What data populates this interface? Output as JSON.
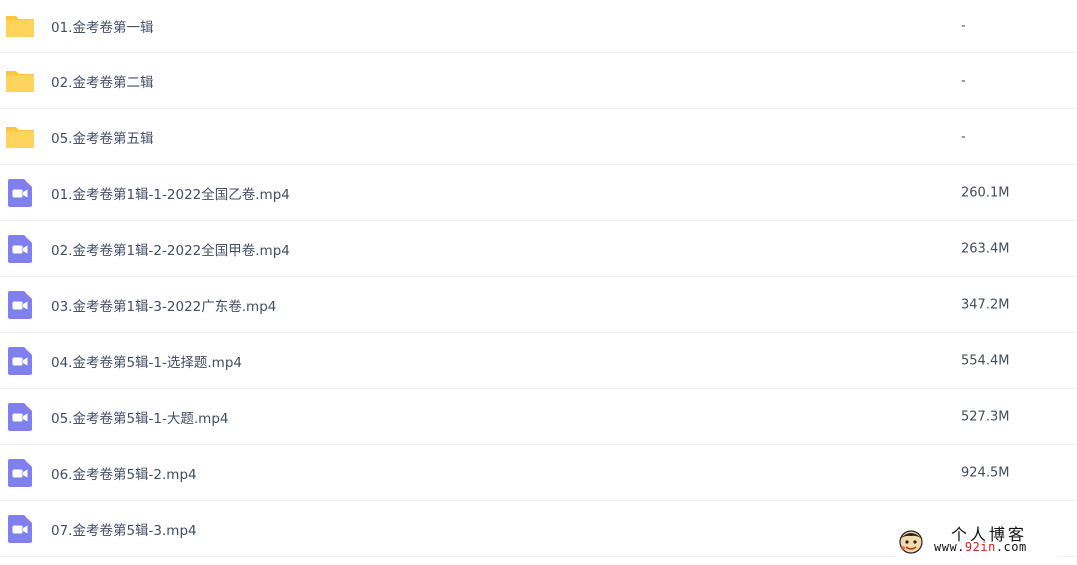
{
  "files": [
    {
      "type": "folder",
      "icon": "folder-icon",
      "name": "01.金考卷第一辑",
      "size": "-"
    },
    {
      "type": "folder",
      "icon": "folder-icon",
      "name": "02.金考卷第二辑",
      "size": "-"
    },
    {
      "type": "folder",
      "icon": "folder-icon",
      "name": "05.金考卷第五辑",
      "size": "-"
    },
    {
      "type": "video",
      "icon": "video-file-icon",
      "name": "01.金考卷第1辑-1-2022全国乙卷.mp4",
      "size": "260.1M"
    },
    {
      "type": "video",
      "icon": "video-file-icon",
      "name": "02.金考卷第1辑-2-2022全国甲卷.mp4",
      "size": "263.4M"
    },
    {
      "type": "video",
      "icon": "video-file-icon",
      "name": "03.金考卷第1辑-3-2022广东卷.mp4",
      "size": "347.2M"
    },
    {
      "type": "video",
      "icon": "video-file-icon",
      "name": "04.金考卷第5辑-1-选择题.mp4",
      "size": "554.4M"
    },
    {
      "type": "video",
      "icon": "video-file-icon",
      "name": "05.金考卷第5辑-1-大题.mp4",
      "size": "527.3M"
    },
    {
      "type": "video",
      "icon": "video-file-icon",
      "name": "06.金考卷第5辑-2.mp4",
      "size": "924.5M"
    },
    {
      "type": "video",
      "icon": "video-file-icon",
      "name": "07.金考卷第5辑-3.mp4",
      "size": ""
    }
  ],
  "watermark": {
    "title": "个人博客",
    "url_prefix": "www.",
    "url_accent": "92in",
    "url_suffix": ".com",
    "logo": "cartoon-face-logo"
  },
  "colors": {
    "folder": "#ffd35c",
    "folder_tab": "#ffc53a",
    "video": "#7f7ff0",
    "divider": "#f1f2f4",
    "text": "#424e67"
  }
}
